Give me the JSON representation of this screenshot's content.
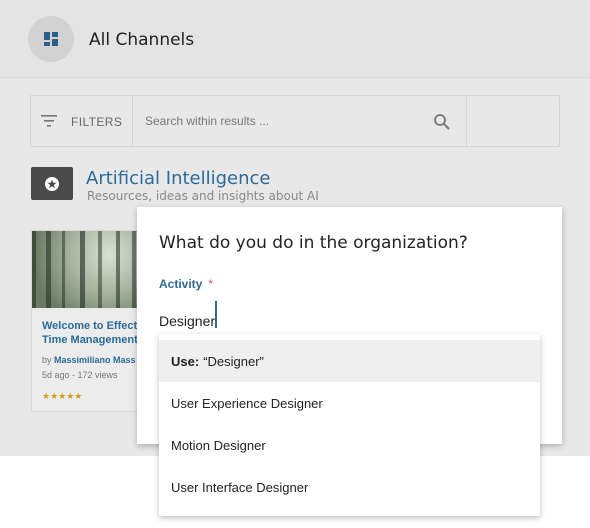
{
  "header": {
    "title": "All Channels",
    "icon": "grid-icon"
  },
  "filterbar": {
    "filters_label": "FILTERS",
    "search_placeholder": "Search within results ..."
  },
  "channel": {
    "title": "Artificial Intelligence",
    "subtitle": "Resources, ideas and insights about AI"
  },
  "card": {
    "title_line1": "Welcome to Effecti",
    "title_line2": "Time Management",
    "by_prefix": "by",
    "author": "Massimiliano Mass",
    "meta": "5d ago - 172 views",
    "stars": "★★★★★"
  },
  "modal": {
    "title": "What do you do in the organization?",
    "field_label": "Activity",
    "required_mark": "*",
    "input_value": "Designer"
  },
  "dropdown": {
    "use_prefix": "Use:",
    "use_value": "“Designer”",
    "options": [
      "User Experience Designer",
      "Motion Designer",
      "User Interface Designer"
    ]
  },
  "colors": {
    "accent": "#2a6b9c",
    "required": "#d9534f",
    "stars": "#d4a017"
  }
}
